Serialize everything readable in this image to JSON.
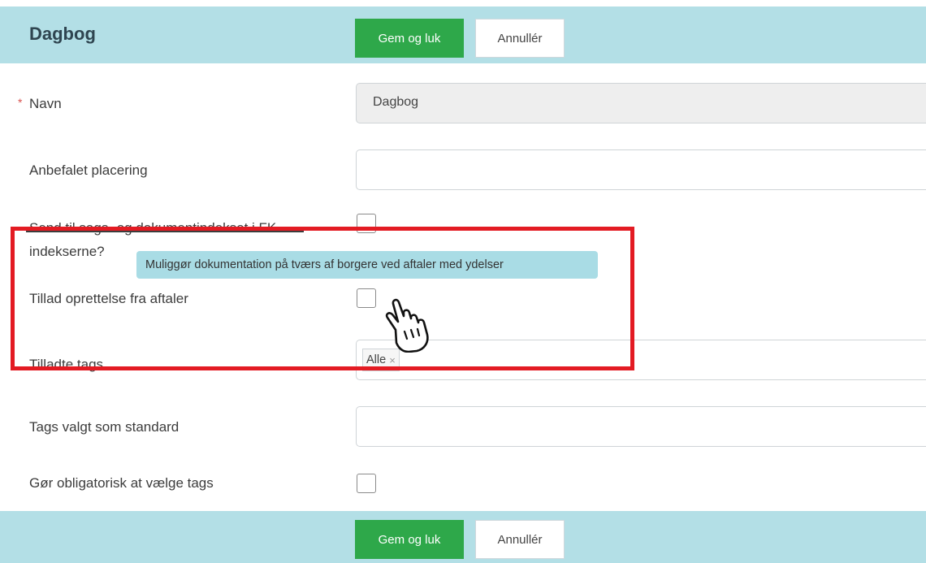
{
  "header": {
    "title": "Dagbog",
    "save_label": "Gem og luk",
    "cancel_label": "Annullér"
  },
  "form": {
    "required_marker": "*",
    "name_label": "Navn",
    "name_value": "Dagbog",
    "placement_label": "Anbefalet placering",
    "placement_value": "",
    "send_index_label_line1": "Send til sags- og dokumentindekset i FK-",
    "send_index_label_line2": "indekserne?",
    "send_index_checked": false,
    "tooltip": "Muliggør dokumentation på tværs af borgere ved aftaler med ydelser",
    "allow_from_agreements_label": "Tillad oprettelse fra aftaler",
    "allow_from_agreements_checked": false,
    "allowed_tags_label": "Tilladte tags",
    "allowed_tags": [
      {
        "label": "Alle",
        "remove": "×"
      }
    ],
    "default_tags_label": "Tags valgt som standard",
    "default_tags_value": "",
    "mandatory_tags_label": "Gør obligatorisk at vælge tags",
    "mandatory_tags_checked": false
  },
  "footer": {
    "save_label": "Gem og luk",
    "cancel_label": "Annullér"
  },
  "colors": {
    "header_bg": "#b3dfe6",
    "primary_button": "#2ea84a",
    "highlight_frame": "#e31b23",
    "tooltip_bg": "#a9dce5"
  },
  "icons": [
    "hand-pointer-cursor-icon",
    "tag-remove-icon"
  ]
}
